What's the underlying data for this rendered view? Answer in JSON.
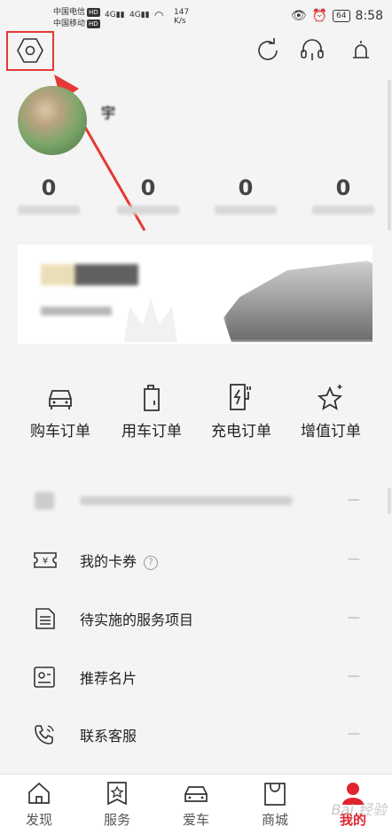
{
  "status_bar": {
    "carrier1": "中国电信",
    "carrier2": "中国移动",
    "hd": "HD",
    "net1": "4G",
    "net2": "4G",
    "speed_value": "147",
    "speed_unit": "K/s",
    "battery": "64",
    "time": "8:58"
  },
  "profile": {
    "username": "宇"
  },
  "stats": [
    {
      "value": "0"
    },
    {
      "value": "0"
    },
    {
      "value": "0"
    },
    {
      "value": "0"
    }
  ],
  "orders": [
    {
      "label": "购车订单",
      "icon": "car-icon"
    },
    {
      "label": "用车订单",
      "icon": "oil-can-icon"
    },
    {
      "label": "充电订单",
      "icon": "charging-icon"
    },
    {
      "label": "增值订单",
      "icon": "star-icon"
    }
  ],
  "menu": [
    {
      "label": "",
      "icon": "blurred-icon"
    },
    {
      "label": "我的卡券",
      "icon": "coupon-icon",
      "help": "?"
    },
    {
      "label": "待实施的服务项目",
      "icon": "service-list-icon"
    },
    {
      "label": "推荐名片",
      "icon": "card-icon"
    },
    {
      "label": "联系客服",
      "icon": "phone-icon"
    }
  ],
  "menu_arrow": "—",
  "tabs": [
    {
      "label": "发现",
      "icon": "home-icon"
    },
    {
      "label": "服务",
      "icon": "service-icon"
    },
    {
      "label": "爱车",
      "icon": "car-icon"
    },
    {
      "label": "商城",
      "icon": "bag-icon"
    },
    {
      "label": "我的",
      "icon": "profile-icon",
      "active": true
    }
  ],
  "watermark": "Bai 经验",
  "colors": {
    "accent": "#e0242f",
    "annotation": "#e53935"
  }
}
